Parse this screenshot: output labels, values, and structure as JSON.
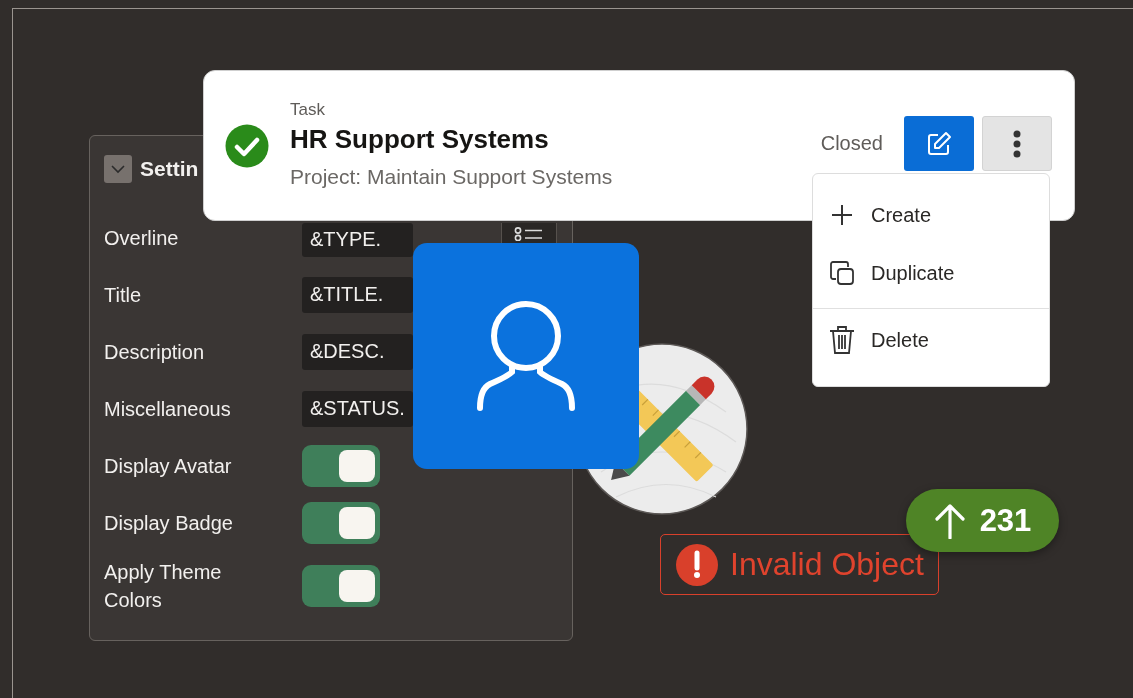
{
  "settings_panel": {
    "title": "Settin",
    "expanded": true,
    "rows": [
      {
        "kind": "field",
        "label": "Overline",
        "value": "&TYPE.",
        "picker": true
      },
      {
        "kind": "field",
        "label": "Title",
        "value": "&TITLE.",
        "picker": false
      },
      {
        "kind": "field",
        "label": "Description",
        "value": "&DESC.",
        "picker": false
      },
      {
        "kind": "field",
        "label": "Miscellaneous",
        "value": "&STATUS.",
        "picker": false
      },
      {
        "kind": "switch",
        "label": "Display Avatar",
        "on": true
      },
      {
        "kind": "switch",
        "label": "Display Badge",
        "on": true
      },
      {
        "kind": "switch",
        "label": "Apply Theme Colors",
        "on": true
      }
    ]
  },
  "card": {
    "overline": "Task",
    "title": "HR Support Systems",
    "description": "Project: Maintain Support Systems",
    "status": "Closed"
  },
  "menu": {
    "items": [
      {
        "label": "Create",
        "divider_above": false
      },
      {
        "label": "Duplicate",
        "divider_above": false
      },
      {
        "label": "Delete",
        "divider_above": true
      }
    ]
  },
  "status_badge": {
    "label": "Invalid Object"
  },
  "counter_badge": {
    "value": "231"
  }
}
